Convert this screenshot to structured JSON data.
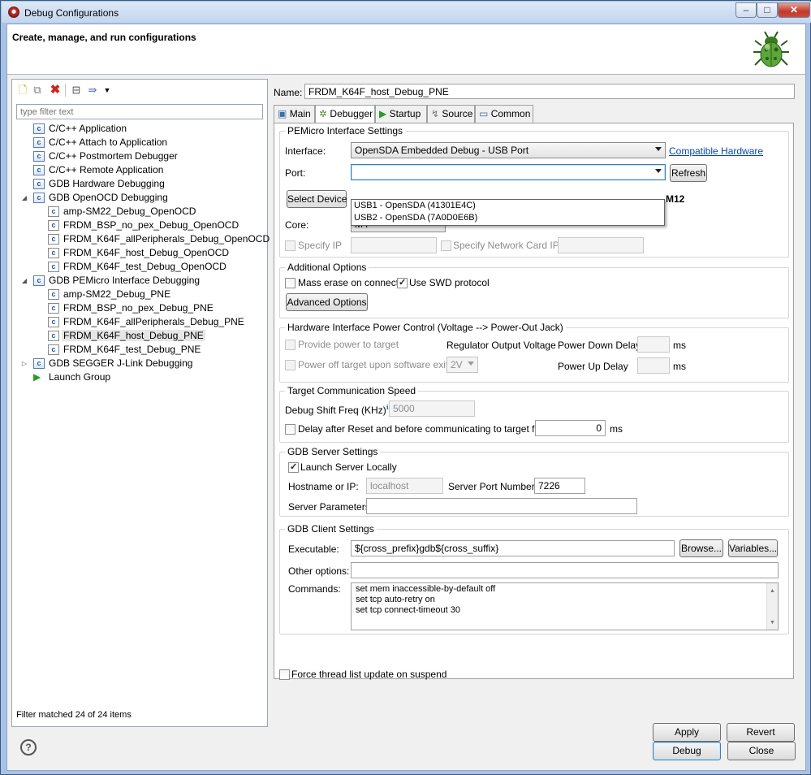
{
  "window": {
    "title": "Debug Configurations"
  },
  "banner": {
    "title": "Create, manage, and run configurations"
  },
  "left": {
    "filter_placeholder": "type filter text",
    "tree": [
      {
        "label": "C/C++ Application",
        "level": 0
      },
      {
        "label": "C/C++ Attach to Application",
        "level": 0
      },
      {
        "label": "C/C++ Postmortem Debugger",
        "level": 0
      },
      {
        "label": "C/C++ Remote Application",
        "level": 0
      },
      {
        "label": "GDB Hardware Debugging",
        "level": 0
      },
      {
        "label": "GDB OpenOCD Debugging",
        "level": 0,
        "expanded": true
      },
      {
        "label": "amp-SM22_Debug_OpenOCD",
        "level": 1
      },
      {
        "label": "FRDM_BSP_no_pex_Debug_OpenOCD",
        "level": 1
      },
      {
        "label": "FRDM_K64F_allPeripherals_Debug_OpenOCD",
        "level": 1
      },
      {
        "label": "FRDM_K64F_host_Debug_OpenOCD",
        "level": 1
      },
      {
        "label": "FRDM_K64F_test_Debug_OpenOCD",
        "level": 1
      },
      {
        "label": "GDB PEMicro Interface Debugging",
        "level": 0,
        "expanded": true
      },
      {
        "label": "amp-SM22_Debug_PNE",
        "level": 1
      },
      {
        "label": "FRDM_BSP_no_pex_Debug_PNE",
        "level": 1
      },
      {
        "label": "FRDM_K64F_allPeripherals_Debug_PNE",
        "level": 1
      },
      {
        "label": "FRDM_K64F_host_Debug_PNE",
        "level": 1,
        "selected": true
      },
      {
        "label": "FRDM_K64F_test_Debug_PNE",
        "level": 1
      },
      {
        "label": "GDB SEGGER J-Link Debugging",
        "level": 0,
        "collapsed": true
      },
      {
        "label": "Launch Group",
        "level": 0,
        "launch": true
      }
    ],
    "status": "Filter matched 24 of 24 items"
  },
  "config": {
    "name_label": "Name:",
    "name_value": "FRDM_K64F_host_Debug_PNE",
    "tabs": [
      "Main",
      "Debugger",
      "Startup",
      "Source",
      "Common"
    ],
    "active_tab": "Debugger"
  },
  "pemicro": {
    "group_label": "PEMicro Interface Settings",
    "interface_label": "Interface:",
    "interface_value": "OpenSDA Embedded Debug - USB Port",
    "compatible_link": "Compatible Hardware",
    "port_label": "Port:",
    "port_value": "",
    "refresh": "Refresh",
    "select_device": "Select Device",
    "device_suffix": "M12",
    "port_options": [
      "USB1 - OpenSDA (41301E4C)",
      "USB2 - OpenSDA (7A0D0E6B)"
    ],
    "core_label": "Core:",
    "core_value": "M4",
    "specify_ip": "Specify IP",
    "specify_nic": "Specify Network Card IP"
  },
  "additional": {
    "group_label": "Additional Options",
    "mass_erase": "Mass erase on connect",
    "use_swd": "Use SWD protocol",
    "advanced_btn": "Advanced Options"
  },
  "power": {
    "group_label": "Hardware Interface Power Control (Voltage --> Power-Out Jack)",
    "provide_power": "Provide power to target",
    "regulator": "Regulator Output Voltage",
    "power_down_delay": "Power Down Delay",
    "ms1": "ms",
    "power_off": "Power off target upon software exit",
    "voltage_value": "2V",
    "power_up_delay": "Power Up Delay",
    "ms2": "ms"
  },
  "speed": {
    "group_label": "Target Communication Speed",
    "freq_label": "Debug Shift Freq (KHz)",
    "freq_value": "5000",
    "delay_label": "Delay after Reset and before communicating to target for",
    "delay_value": "0",
    "ms": "ms"
  },
  "server": {
    "group_label": "GDB Server Settings",
    "launch_locally": "Launch Server Locally",
    "hostname_label": "Hostname or IP:",
    "hostname_value": "localhost",
    "port_label": "Server Port Number:",
    "port_value": "7226",
    "params_label": "Server Parameters:",
    "params_value": ""
  },
  "client": {
    "group_label": "GDB Client Settings",
    "exe_label": "Executable:",
    "exe_value": "${cross_prefix}gdb${cross_suffix}",
    "browse": "Browse...",
    "variables": "Variables...",
    "other_label": "Other options:",
    "other_value": "",
    "commands_label": "Commands:",
    "commands": [
      "set mem inaccessible-by-default off",
      "set tcp auto-retry on",
      "set tcp connect-timeout 30"
    ]
  },
  "force_thread": "Force thread list update on suspend",
  "buttons": {
    "apply": "Apply",
    "revert": "Revert",
    "debug": "Debug",
    "close": "Close"
  }
}
